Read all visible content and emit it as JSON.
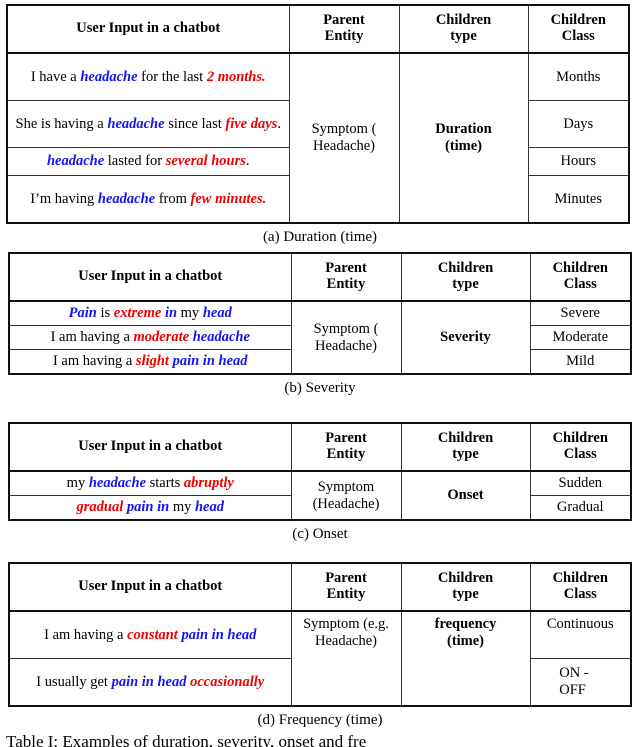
{
  "columns": {
    "user_input": "User Input in a chatbot",
    "parent_entity_line1": "Parent",
    "parent_entity_line2": "Entity",
    "children_type_line1": "Children",
    "children_type_line2": "type",
    "children_class_line1": "Children",
    "children_class_line2": "Class"
  },
  "figures": [
    {
      "id": "duration",
      "caption": "(a) Duration (time)",
      "parent_entity_line1": "Symptom (",
      "parent_entity_line2": "Headache)",
      "children_type_line1": "Duration",
      "children_type_line2": "(time)",
      "rows": [
        {
          "tokens": [
            {
              "t": "I have a ",
              "c": "plain"
            },
            {
              "t": "headache",
              "c": "blue"
            },
            {
              "t": " for the last ",
              "c": "plain"
            },
            {
              "t": "2 months.",
              "c": "red"
            }
          ],
          "children_class": "Months"
        },
        {
          "tokens": [
            {
              "t": "She is having a ",
              "c": "plain"
            },
            {
              "t": "headache",
              "c": "blue"
            },
            {
              "t": " since last ",
              "c": "plain"
            },
            {
              "t": "five days",
              "c": "red"
            },
            {
              "t": ".",
              "c": "plain"
            }
          ],
          "children_class": "Days"
        },
        {
          "tokens": [
            {
              "t": "headache",
              "c": "blue"
            },
            {
              "t": " lasted for ",
              "c": "plain"
            },
            {
              "t": "several hours",
              "c": "red"
            },
            {
              "t": ".",
              "c": "plain"
            }
          ],
          "children_class": "Hours"
        },
        {
          "tokens": [
            {
              "t": "I’m having ",
              "c": "plain"
            },
            {
              "t": "headache",
              "c": "blue"
            },
            {
              "t": " from ",
              "c": "plain"
            },
            {
              "t": "few minutes.",
              "c": "red"
            }
          ],
          "children_class": "Minutes"
        }
      ]
    },
    {
      "id": "severity",
      "caption": "(b) Severity",
      "parent_entity_line1": "Symptom (",
      "parent_entity_line2": "Headache)",
      "children_type_line1": "Severity",
      "children_type_line2": "",
      "rows": [
        {
          "tokens": [
            {
              "t": "Pain",
              "c": "blue"
            },
            {
              "t": " is ",
              "c": "plain"
            },
            {
              "t": "extreme",
              "c": "red"
            },
            {
              "t": " ",
              "c": "plain"
            },
            {
              "t": "in",
              "c": "blue"
            },
            {
              "t": " my ",
              "c": "plain"
            },
            {
              "t": "head",
              "c": "blue"
            }
          ],
          "children_class": "Severe"
        },
        {
          "tokens": [
            {
              "t": "I am having a ",
              "c": "plain"
            },
            {
              "t": "moderate",
              "c": "red"
            },
            {
              "t": " ",
              "c": "plain"
            },
            {
              "t": "headache",
              "c": "blue"
            }
          ],
          "children_class": "Moderate"
        },
        {
          "tokens": [
            {
              "t": "I am having a ",
              "c": "plain"
            },
            {
              "t": "slight",
              "c": "red"
            },
            {
              "t": " ",
              "c": "plain"
            },
            {
              "t": "pain in head",
              "c": "blue"
            }
          ],
          "children_class": "Mild"
        }
      ]
    },
    {
      "id": "onset",
      "caption": "(c) Onset",
      "parent_entity_line1": "Symptom",
      "parent_entity_line2": "(Headache)",
      "children_type_line1": "Onset",
      "children_type_line2": "",
      "rows": [
        {
          "tokens": [
            {
              "t": "my ",
              "c": "plain"
            },
            {
              "t": "headache",
              "c": "blue"
            },
            {
              "t": " starts ",
              "c": "plain"
            },
            {
              "t": "abruptly",
              "c": "red"
            }
          ],
          "children_class": "Sudden"
        },
        {
          "tokens": [
            {
              "t": "gradual",
              "c": "red"
            },
            {
              "t": " ",
              "c": "plain"
            },
            {
              "t": "pain in",
              "c": "blue"
            },
            {
              "t": " my ",
              "c": "plain"
            },
            {
              "t": "head",
              "c": "blue"
            }
          ],
          "children_class": "Gradual"
        }
      ]
    },
    {
      "id": "frequency",
      "caption": "(d) Frequency (time)",
      "parent_entity_line1": "Symptom (e.g.",
      "parent_entity_line2": "Headache)",
      "children_type_line1": "frequency",
      "children_type_line2": "(time)",
      "rows": [
        {
          "tokens": [
            {
              "t": "I am having a ",
              "c": "plain"
            },
            {
              "t": "constant",
              "c": "red"
            },
            {
              "t": " ",
              "c": "plain"
            },
            {
              "t": "pain in head",
              "c": "blue"
            }
          ],
          "children_class": "Continuous"
        },
        {
          "tokens": [
            {
              "t": "I usually get ",
              "c": "plain"
            },
            {
              "t": "pain in head",
              "c": "blue"
            },
            {
              "t": " ",
              "c": "plain"
            },
            {
              "t": "occasionally",
              "c": "red"
            }
          ],
          "children_class": "ON - OFF"
        }
      ]
    }
  ],
  "table_caption": "Table I: Examples of duration, severity, onset and fre"
}
